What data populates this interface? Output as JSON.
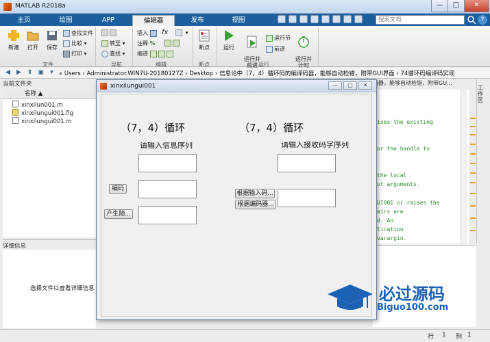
{
  "window": {
    "title": "MATLAB R2018a",
    "min": "—",
    "max": "□",
    "close": "✕"
  },
  "tabs": [
    {
      "label": "主页"
    },
    {
      "label": "绘图"
    },
    {
      "label": "APP"
    },
    {
      "label": "编辑器",
      "active": true
    },
    {
      "label": "发布"
    },
    {
      "label": "视图"
    }
  ],
  "search": {
    "placeholder": "搜索文档"
  },
  "ribbon": {
    "file": {
      "new": "新建",
      "open": "打开",
      "save": "保存",
      "find_files": "查找文件",
      "compare": "比较",
      "print": "打印",
      "group": "文件"
    },
    "navigate": {
      "goto": "转至",
      "find": "查找",
      "group": "导航"
    },
    "edit": {
      "insert": "插入",
      "comment": "注释",
      "indent": "缩进",
      "fx": "fx",
      "percent": "%",
      "group": "编辑"
    },
    "breakpoints": {
      "label": "断点",
      "group": "断点"
    },
    "run": {
      "run": "运行",
      "run_advance": "运行并\n前进",
      "run_section": "运行节",
      "advance": "前进",
      "run_time": "运行并\n计时",
      "group": "运行"
    }
  },
  "address": {
    "path": "« Users › Administrator.WIN7U-20180127Z › Desktop › 信息论中（7，4）循环码的编译码器，能够自动检错，附带GUI界面 › 74循环码编译码实现"
  },
  "left_panel": {
    "current_folder": "当前文件夹",
    "column_name": "名称 ▲",
    "files": [
      {
        "name": "xinxilun001.m",
        "type": "m"
      },
      {
        "name": "xinxilungui001.fig",
        "type": "fig"
      },
      {
        "name": "xinxilungui001.m",
        "type": "m"
      }
    ],
    "details_header": "详细信息",
    "details_msg": "选择文件以查看详细信息"
  },
  "editor": {
    "tab_text": "码器，能够自动检错，附带GU...",
    "lines": [
      "ises the existing",
      "or the handle to",
      "the local",
      "ut arguments.",
      "UI001 or raises the",
      "airs are",
      "d.  An",
      "lication",
      "varargin."
    ],
    "side_label": "工作区"
  },
  "status": {
    "row_label": "行",
    "row": "1",
    "col_label": "列",
    "col": "1"
  },
  "dialog": {
    "title": "xinxilungui001",
    "left_title": "（7，4）循环",
    "right_title": "（7，4）循环",
    "left_label": "请输入信息序列",
    "right_label": "请输入接收码字序列",
    "encode_btn": "编码",
    "random_btn": "产生随...",
    "by_input_btn": "根据输入码...",
    "by_encoder_btn": "根据编码器..."
  },
  "watermark": {
    "text": "必过源码",
    "url": "Biguo100.com"
  }
}
